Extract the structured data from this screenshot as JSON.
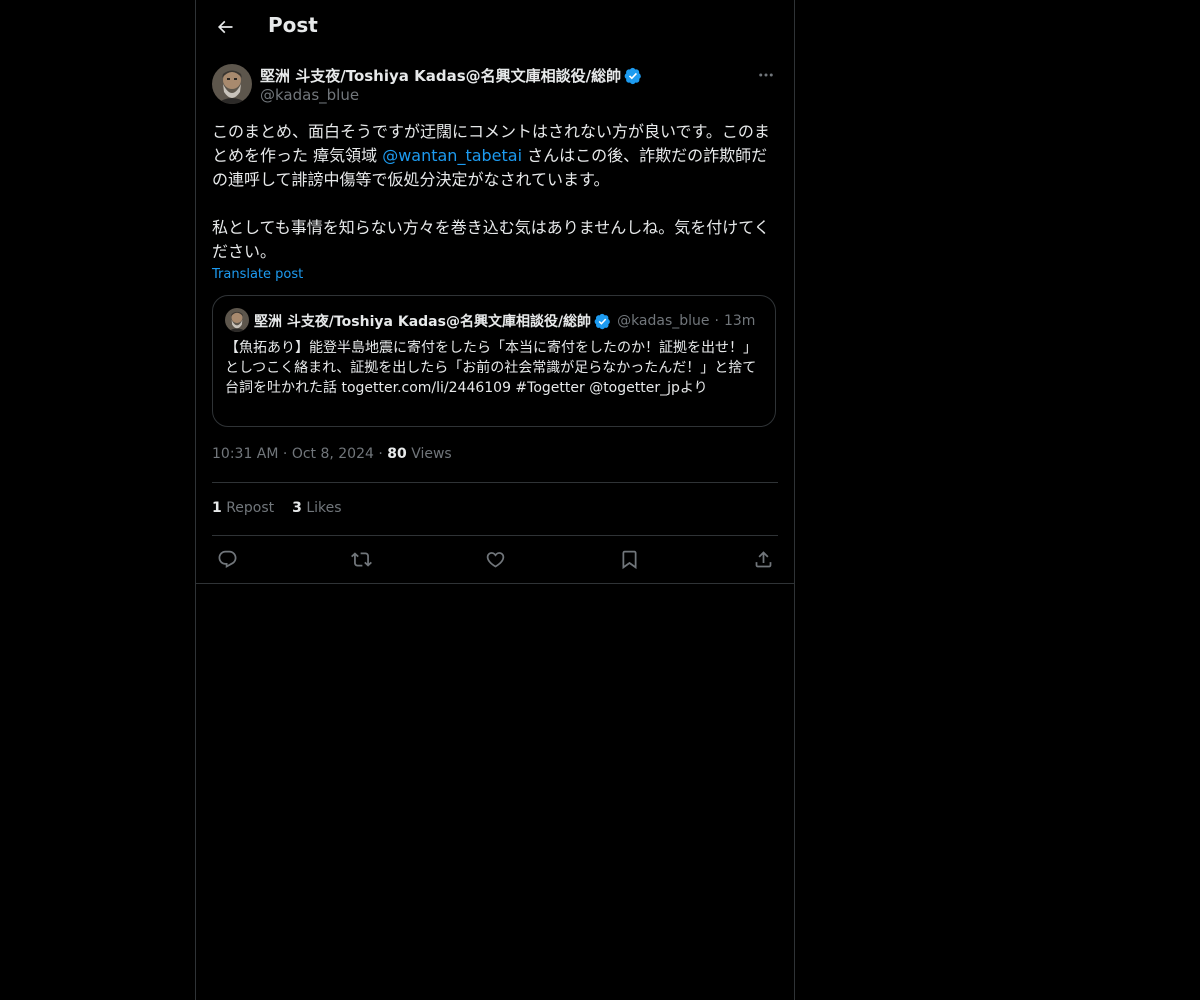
{
  "header": {
    "title": "Post"
  },
  "post": {
    "author_name": "堅洲 斗支夜/Toshiya Kadas@名興文庫相談役/総帥",
    "handle": "@kadas_blue",
    "body_line1_a": "このまとめ、面白そうですが迂闊にコメントはされない方が良いです。このまとめを作った 瘴気領域 ",
    "mention": "@wantan_tabetai",
    "body_line1_b": " さんはこの後、詐欺だの詐欺師だの連呼して誹謗中傷等で仮処分決定がなされています。",
    "body_line2": "私としても事情を知らない方々を巻き込む気はありませんしね。気を付けてください。",
    "translate_label": "Translate post",
    "timestamp": "10:31 AM",
    "date": "Oct 8, 2024",
    "views_count": "80",
    "views_label": "Views",
    "reposts_count": "1",
    "reposts_label": "Repost",
    "likes_count": "3",
    "likes_label": "Likes"
  },
  "quote": {
    "author_name": "堅洲 斗支夜/Toshiya Kadas@名興文庫相談役/総帥",
    "handle": "@kadas_blue",
    "time": "13m",
    "text": "【魚拓あり】能登半島地震に寄付をしたら「本当に寄付をしたのか！証拠を出せ！」としつこく絡まれ、証拠を出したら「お前の社会常識が足らなかったんだ！」と捨て台詞を吐かれた話 togetter.com/li/2446109 #Togetter @togetter_jpより"
  },
  "colors": {
    "accent": "#1d9bf0",
    "text": "#e7e9ea",
    "muted": "#71767b",
    "border": "#2f3336"
  },
  "icons": [
    "back-arrow-icon",
    "verified-badge-icon",
    "more-icon",
    "reply-icon",
    "repost-icon",
    "like-icon",
    "bookmark-icon",
    "share-icon"
  ]
}
